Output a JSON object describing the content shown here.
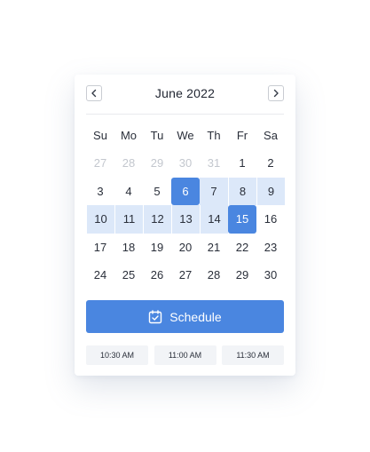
{
  "calendar": {
    "month_title": "June 2022",
    "prev_icon": "chevron-left-icon",
    "next_icon": "chevron-right-icon",
    "weekdays": [
      "Su",
      "Mo",
      "Tu",
      "We",
      "Th",
      "Fr",
      "Sa"
    ],
    "weeks": [
      [
        "27",
        "28",
        "29",
        "30",
        "31",
        "1",
        "2"
      ],
      [
        "3",
        "4",
        "5",
        "6",
        "7",
        "8",
        "9"
      ],
      [
        "10",
        "11",
        "12",
        "13",
        "14",
        "15",
        "16"
      ],
      [
        "17",
        "18",
        "19",
        "20",
        "21",
        "22",
        "23"
      ],
      [
        "24",
        "25",
        "26",
        "27",
        "28",
        "29",
        "30"
      ]
    ],
    "muted_days": [
      "27",
      "28",
      "29",
      "30"
    ],
    "range_start": "6",
    "range_end": "15"
  },
  "schedule": {
    "label": "Schedule",
    "icon": "calendar-check-icon"
  },
  "time_slots": [
    "10:30 AM",
    "11:00 AM",
    "11:30 AM"
  ],
  "colors": {
    "accent": "#4a86e0",
    "range_fill": "#dce8f9",
    "muted_text": "#c3c7ce",
    "slot_bg": "#f2f4f7"
  }
}
